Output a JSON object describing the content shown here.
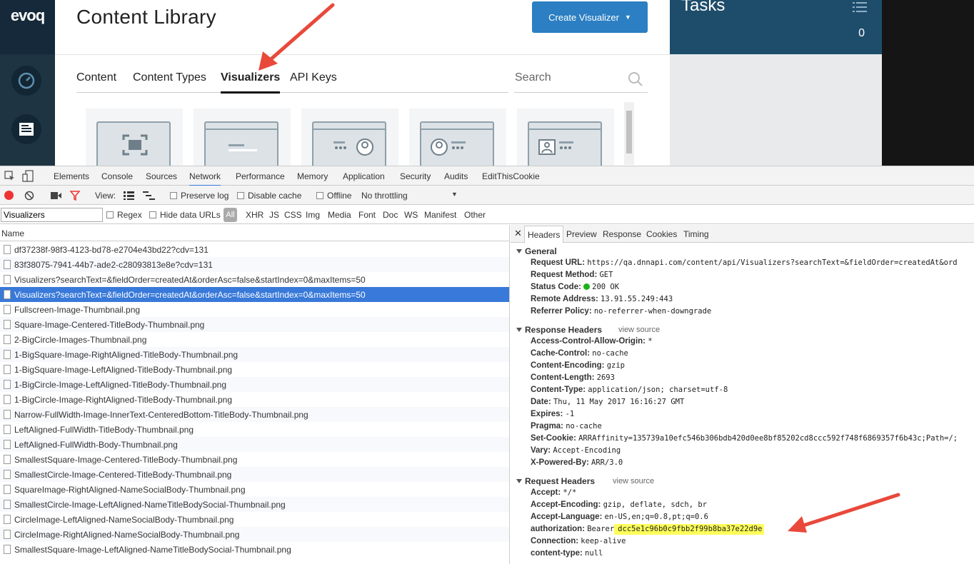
{
  "app": {
    "logo": "evoq",
    "title": "Content Library",
    "create_button": "Create Visualizer",
    "tabs": [
      "Content",
      "Content Types",
      "Visualizers",
      "API Keys"
    ],
    "active_tab": "Visualizers",
    "search_placeholder": "Search",
    "tasks_title": "Tasks",
    "tasks_count": "0"
  },
  "devtools": {
    "tabs": [
      "Elements",
      "Console",
      "Sources",
      "Network",
      "Performance",
      "Memory",
      "Application",
      "Security",
      "Audits",
      "EditThisCookie"
    ],
    "active_tab": "Network",
    "toolbar": {
      "view_label": "View:",
      "preserve_log": "Preserve log",
      "disable_cache": "Disable cache",
      "offline": "Offline",
      "throttling": "No throttling"
    },
    "filter": {
      "value": "Visualizers",
      "regex": "Regex",
      "hide_data_urls": "Hide data URLs",
      "types": [
        "All",
        "XHR",
        "JS",
        "CSS",
        "Img",
        "Media",
        "Font",
        "Doc",
        "WS",
        "Manifest",
        "Other"
      ]
    },
    "list_header": "Name",
    "requests": [
      "df37238f-98f3-4123-bd78-e2704e43bd22?cdv=131",
      "83f38075-7941-44b7-ade2-c28093813e8e?cdv=131",
      "Visualizers?searchText=&fieldOrder=createdAt&orderAsc=false&startIndex=0&maxItems=50",
      "Visualizers?searchText=&fieldOrder=createdAt&orderAsc=false&startIndex=0&maxItems=50",
      "Fullscreen-Image-Thumbnail.png",
      "Square-Image-Centered-TitleBody-Thumbnail.png",
      "2-BigCircle-Images-Thumbnail.png",
      "1-BigSquare-Image-RightAligned-TitleBody-Thumbnail.png",
      "1-BigSquare-Image-LeftAligned-TitleBody-Thumbnail.png",
      "1-BigCircle-Image-LeftAligned-TitleBody-Thumbnail.png",
      "1-BigCircle-Image-RightAligned-TitleBody-Thumbnail.png",
      "Narrow-FullWidth-Image-InnerText-CenteredBottom-TitleBody-Thumbnail.png",
      "LeftAligned-FullWidth-TitleBody-Thumbnail.png",
      "LeftAligned-FullWidth-Body-Thumbnail.png",
      "SmallestSquare-Image-Centered-TitleBody-Thumbnail.png",
      "SmallestCircle-Image-Centered-TitleBody-Thumbnail.png",
      "SquareImage-RightAligned-NameSocialBody-Thumbnail.png",
      "SmallestCircle-Image-LeftAligned-NameTitleBodySocial-Thumbnail.png",
      "CircleImage-LeftAligned-NameSocialBody-Thumbnail.png",
      "CircleImage-RightAligned-NameSocialBody-Thumbnail.png",
      "SmallestSquare-Image-LeftAligned-NameTitleBodySocial-Thumbnail.png"
    ],
    "detail_tabs": [
      "Headers",
      "Preview",
      "Response",
      "Cookies",
      "Timing"
    ],
    "general_title": "General",
    "general": [
      {
        "k": "Request URL:",
        "v": "https://qa.dnnapi.com/content/api/Visualizers?searchText=&fieldOrder=createdAt&ord"
      },
      {
        "k": "Request Method:",
        "v": "GET"
      },
      {
        "k": "Status Code:",
        "v": "200 OK"
      },
      {
        "k": "Remote Address:",
        "v": "13.91.55.249:443"
      },
      {
        "k": "Referrer Policy:",
        "v": "no-referrer-when-downgrade"
      }
    ],
    "response_title": "Response Headers",
    "view_source": "view source",
    "response_headers": [
      {
        "k": "Access-Control-Allow-Origin:",
        "v": "*"
      },
      {
        "k": "Cache-Control:",
        "v": "no-cache"
      },
      {
        "k": "Content-Encoding:",
        "v": "gzip"
      },
      {
        "k": "Content-Length:",
        "v": "2693"
      },
      {
        "k": "Content-Type:",
        "v": "application/json; charset=utf-8"
      },
      {
        "k": "Date:",
        "v": "Thu, 11 May 2017 16:16:27 GMT"
      },
      {
        "k": "Expires:",
        "v": "-1"
      },
      {
        "k": "Pragma:",
        "v": "no-cache"
      },
      {
        "k": "Set-Cookie:",
        "v": "ARRAffinity=135739a10efc546b306bdb420d0ee8bf85202cd8ccc592f748f6869357f6b43c;Path=/;"
      },
      {
        "k": "Vary:",
        "v": "Accept-Encoding"
      },
      {
        "k": "X-Powered-By:",
        "v": "ARR/3.0"
      }
    ],
    "request_title": "Request Headers",
    "request_headers": [
      {
        "k": "Accept:",
        "v": "*/*"
      },
      {
        "k": "Accept-Encoding:",
        "v": "gzip, deflate, sdch, br"
      },
      {
        "k": "Accept-Language:",
        "v": "en-US,en;q=0.8,pt;q=0.6"
      },
      {
        "k": "authorization:",
        "v": "Bearer"
      },
      {
        "k": "Connection:",
        "v": "keep-alive"
      },
      {
        "k": "content-type:",
        "v": "null"
      }
    ],
    "auth_token": "dcc5e1c96b0c9fbb2f99b8ba37e22d9e"
  },
  "colors": {
    "accent": "#2b7fc2",
    "selected_row": "#3879d9",
    "annotation_arrow": "#e8493b",
    "highlight": "#ffff5a"
  }
}
